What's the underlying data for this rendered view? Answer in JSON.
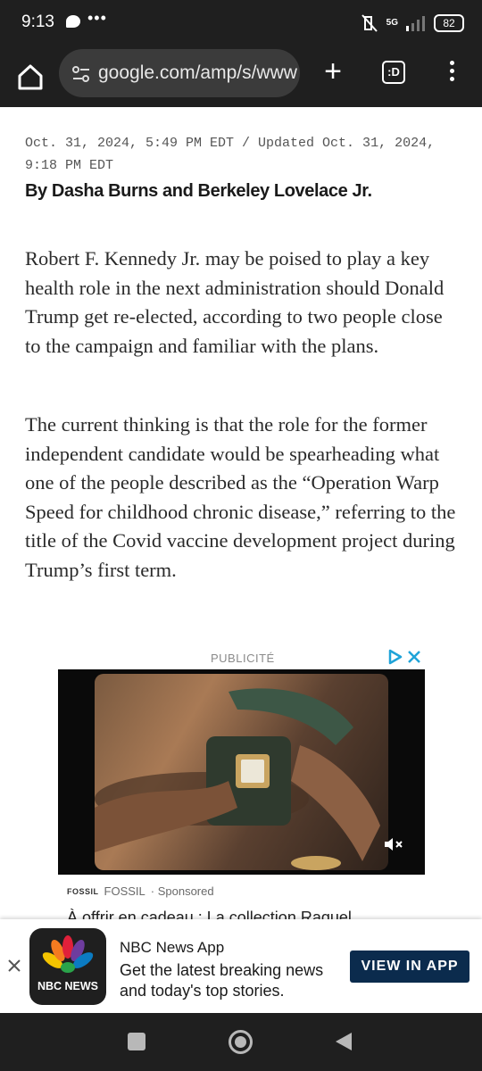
{
  "status_bar": {
    "time": "9:13",
    "network": "5G",
    "battery": "82"
  },
  "browser": {
    "url": "google.com/amp/s/www",
    "tabs_label": ":D"
  },
  "article": {
    "dateline": "Oct. 31, 2024, 5:49 PM EDT / Updated Oct. 31, 2024, 9:18 PM EDT",
    "byline": "By Dasha Burns and Berkeley Lovelace Jr.",
    "paragraphs": [
      "Robert F. Kennedy Jr. may be poised to play a key health role in the next administration should Donald Trump get re-elected, according to two people close to the campaign and familiar with the plans.",
      "The current thinking is that the role for the former independent candidate would be spearheading what one of the people described as the “Operation Warp Speed for childhood chronic disease,” referring to the title of the Covid vaccine development project during Trump’s first term."
    ]
  },
  "ad": {
    "label": "PUBLICITÉ",
    "logo_text": "FOSSIL",
    "advertiser": "FOSSIL",
    "sponsored": "· Sponsored",
    "headline": "À offrir en cadeau : La collection Raquel"
  },
  "app_banner": {
    "logo_text": "NBC NEWS",
    "title": "NBC News App",
    "subtitle": "Get the latest breaking news and today's top stories.",
    "cta": "VIEW IN APP"
  },
  "colors": {
    "chrome": "#1f1f1f",
    "cta_bg": "#0b2b4d",
    "adchoices": "#1fa3d8"
  }
}
